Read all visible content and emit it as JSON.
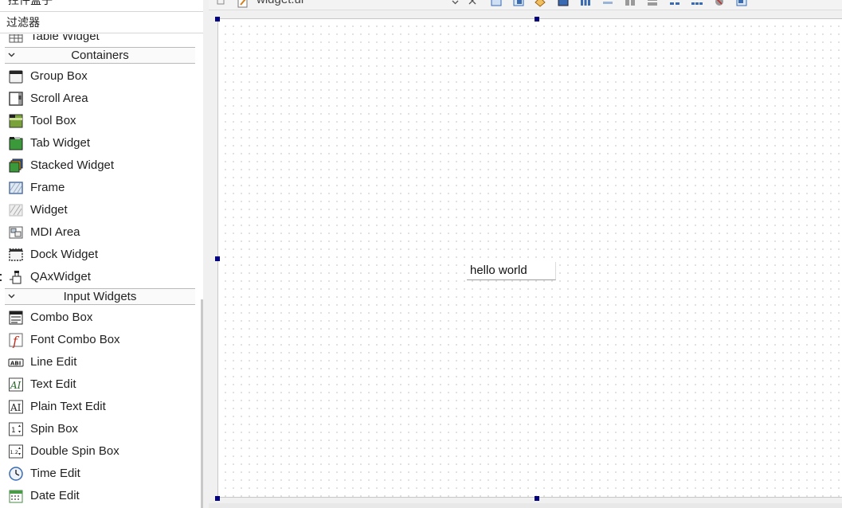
{
  "widget_box": {
    "title": "控件盒子",
    "filter_placeholder": "过滤器",
    "partial_item": {
      "label": "Table Widget",
      "icon": "table-widget-icon"
    },
    "categories": [
      {
        "label": "Containers",
        "items": [
          {
            "label": "Group Box",
            "icon": "group-box-icon"
          },
          {
            "label": "Scroll Area",
            "icon": "scroll-area-icon"
          },
          {
            "label": "Tool Box",
            "icon": "tool-box-icon"
          },
          {
            "label": "Tab Widget",
            "icon": "tab-widget-icon"
          },
          {
            "label": "Stacked Widget",
            "icon": "stacked-widget-icon"
          },
          {
            "label": "Frame",
            "icon": "frame-icon"
          },
          {
            "label": "Widget",
            "icon": "widget-icon"
          },
          {
            "label": "MDI Area",
            "icon": "mdi-area-icon"
          },
          {
            "label": "Dock Widget",
            "icon": "dock-widget-icon"
          },
          {
            "label": "QAxWidget",
            "icon": "qaxwidget-icon"
          }
        ]
      },
      {
        "label": "Input Widgets",
        "items": [
          {
            "label": "Combo Box",
            "icon": "combo-box-icon"
          },
          {
            "label": "Font Combo Box",
            "icon": "font-combo-box-icon"
          },
          {
            "label": "Line Edit",
            "icon": "line-edit-icon"
          },
          {
            "label": "Text Edit",
            "icon": "text-edit-icon"
          },
          {
            "label": "Plain Text Edit",
            "icon": "plain-text-edit-icon"
          },
          {
            "label": "Spin Box",
            "icon": "spin-box-icon"
          },
          {
            "label": "Double Spin Box",
            "icon": "double-spin-box-icon"
          },
          {
            "label": "Time Edit",
            "icon": "time-edit-icon"
          },
          {
            "label": "Date Edit",
            "icon": "date-edit-icon"
          }
        ]
      }
    ]
  },
  "editor": {
    "file_tab": "widget.ui"
  },
  "form": {
    "label_text": "hello world"
  },
  "colors": {
    "selection_handle": "#000080",
    "canvas_bg": "#ffffff",
    "grid_dot": "#9a9a9a"
  }
}
